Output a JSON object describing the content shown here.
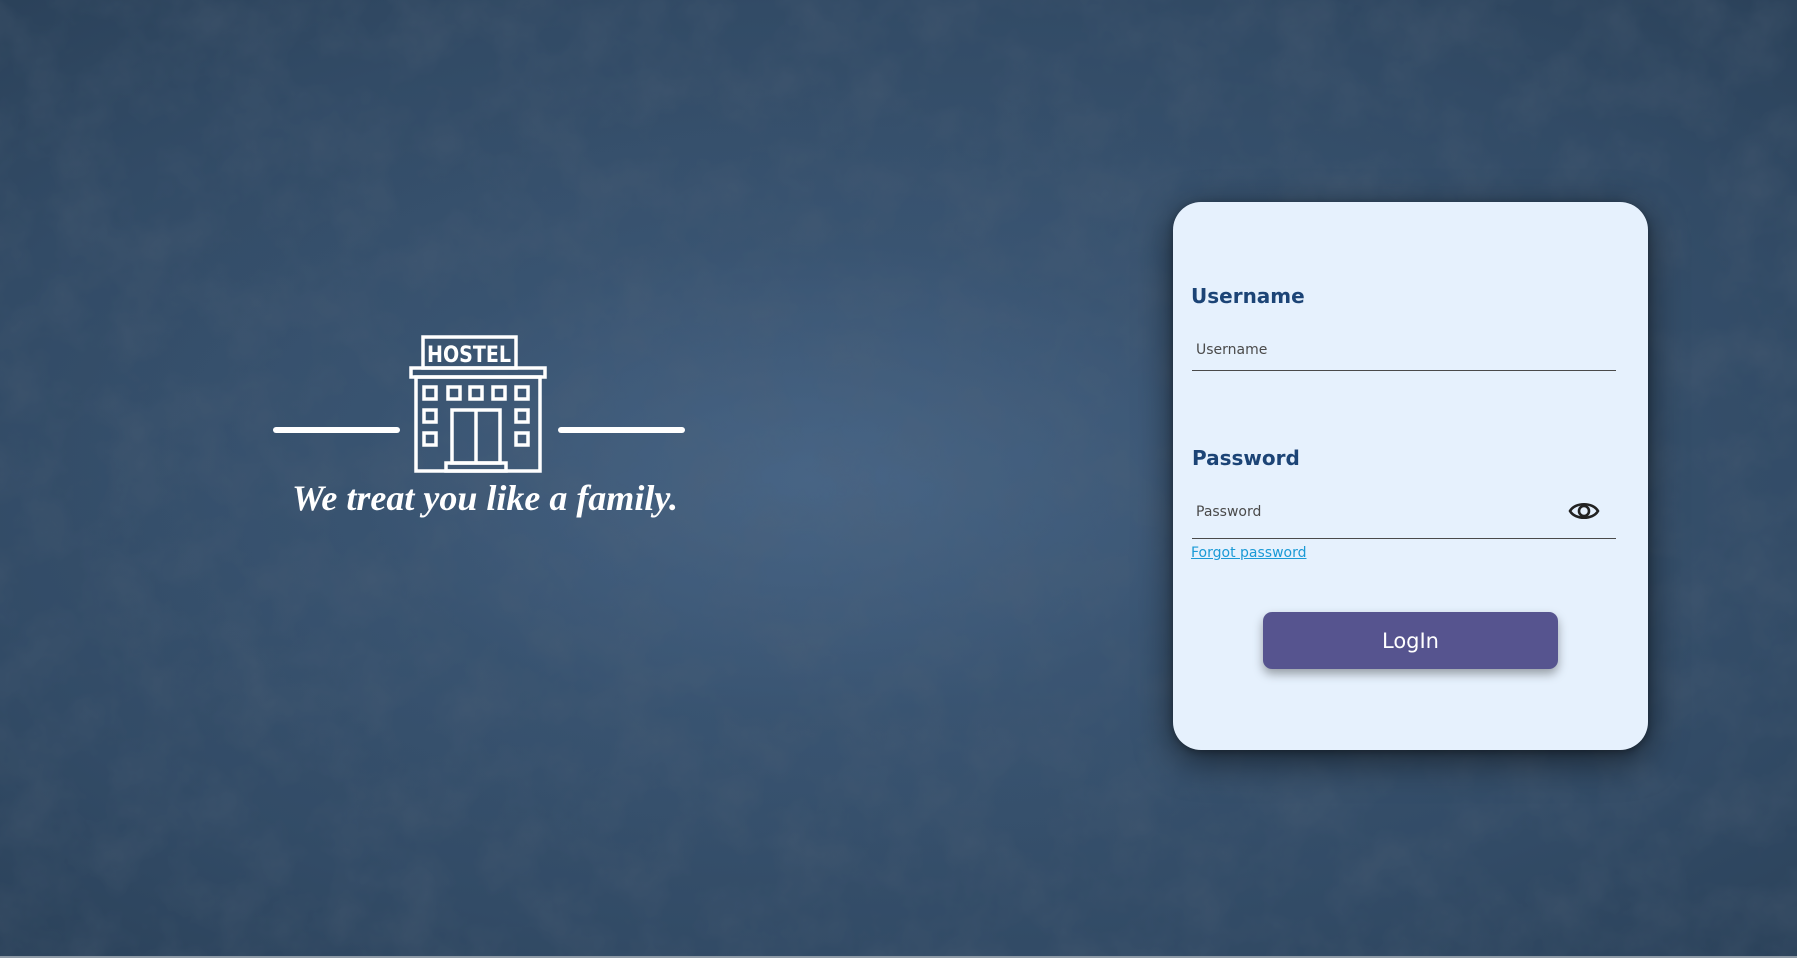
{
  "brand": {
    "sign_text": "HOSTEL",
    "tagline": "We treat you like a family.",
    "icon": "hostel-building-icon"
  },
  "login": {
    "username_label": "Username",
    "username_placeholder": "Username",
    "username_value": "",
    "password_label": "Password",
    "password_placeholder": "Password",
    "password_value": "",
    "show_password_icon": "eye-icon",
    "forgot_password_label": "Forgot password",
    "login_button_label": "LogIn"
  },
  "colors": {
    "background": "#324b66",
    "card_background": "#e6f1fd",
    "label_color": "#1c4476",
    "link_color": "#1a9ad6",
    "button_color": "#56548f",
    "button_text": "#ffffff"
  }
}
